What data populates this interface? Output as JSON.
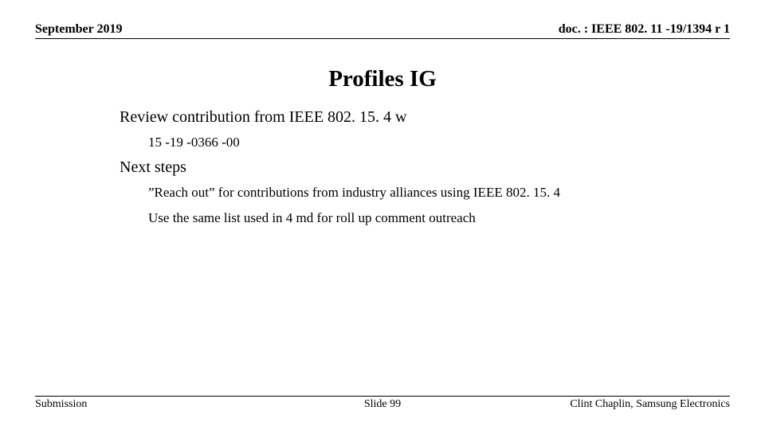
{
  "header": {
    "date": "September 2019",
    "doc": "doc. : IEEE 802. 11 -19/1394 r 1"
  },
  "title": "Profiles IG",
  "sections": [
    {
      "heading": "Review contribution from IEEE 802. 15. 4 w",
      "items": [
        "15 -19 -0366 -00"
      ]
    },
    {
      "heading": "Next steps",
      "items": [
        "”Reach out” for contributions from industry alliances using IEEE 802. 15. 4",
        "Use the same list used in 4 md for roll up comment outreach"
      ]
    }
  ],
  "footer": {
    "left": "Submission",
    "center": "Slide 99",
    "right": "Clint Chaplin, Samsung Electronics"
  }
}
